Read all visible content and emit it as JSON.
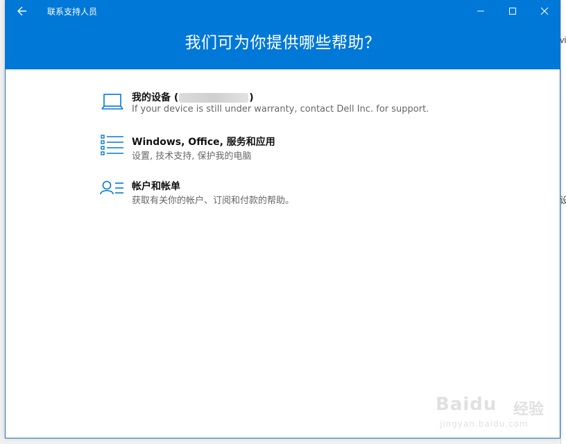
{
  "window": {
    "app_title": "联系支持人员",
    "accent": "#0078d7"
  },
  "header": {
    "title": "我们可为你提供哪些帮助？"
  },
  "options": [
    {
      "icon": "laptop-icon",
      "title_prefix": "我的设备 (",
      "title_suffix": ")",
      "description": "If your device is still under warranty, contact Dell Inc. for support."
    },
    {
      "icon": "list-icon",
      "title": "Windows, Office, 服务和应用",
      "description": "设置, 技术支持, 保护我的电脑"
    },
    {
      "icon": "account-icon",
      "title": "帐户和帐单",
      "description": "获取有关你的帐户、订阅和付款的帮助。"
    }
  ],
  "background": {
    "peek_text_top": "vi",
    "peek_text_mid": "设"
  },
  "watermark": {
    "logo": "Baidu",
    "cn": "经验",
    "url": "jingyan.baidu.com"
  }
}
